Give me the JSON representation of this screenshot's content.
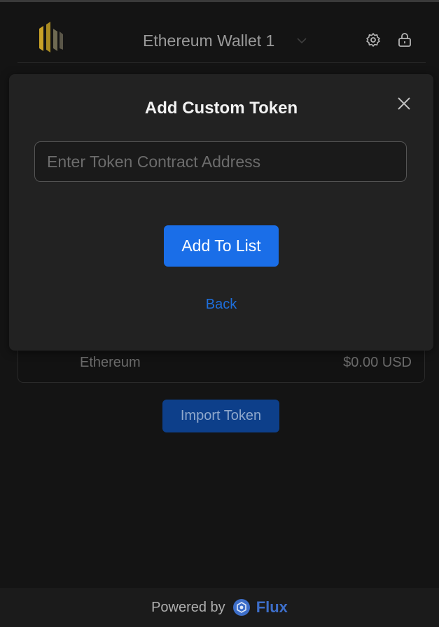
{
  "header": {
    "wallet_name": "Ethereum Wallet 1",
    "logo_icon": "wallet-logo-icon",
    "settings_icon": "gear-icon",
    "lock_icon": "lock-icon",
    "chevron_icon": "chevron-down-icon"
  },
  "asset": {
    "name": "Ethereum",
    "value": "$0.00 USD"
  },
  "import_button_label": "Import Token",
  "footer": {
    "powered_by": "Powered by",
    "brand": "Flux",
    "brand_icon": "flux-logo-icon"
  },
  "modal": {
    "title": "Add Custom Token",
    "input_placeholder": "Enter Token Contract Address",
    "input_value": "",
    "add_button_label": "Add To List",
    "back_label": "Back",
    "close_icon": "close-icon"
  },
  "colors": {
    "accent": "#1a6ee8",
    "logo_gold": "#c9a227",
    "background": "#141414",
    "modal_background": "#222222",
    "link": "#1e6fdc"
  }
}
